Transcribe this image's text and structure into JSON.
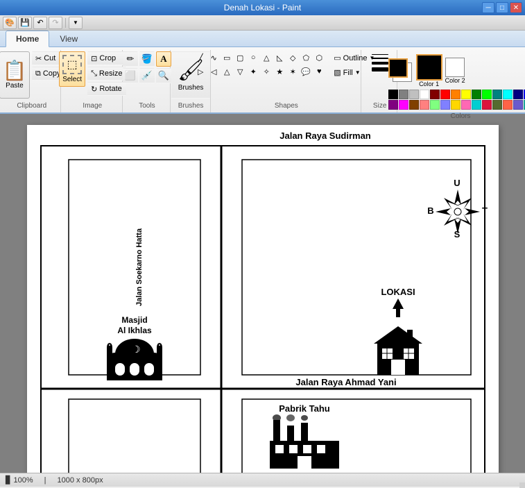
{
  "titleBar": {
    "title": "Denah Lokasi - Paint",
    "minBtn": "─",
    "maxBtn": "□",
    "closeBtn": "✕"
  },
  "quickAccess": {
    "saveLabel": "💾",
    "undoLabel": "↶",
    "redoLabel": "↷"
  },
  "tabs": {
    "items": [
      {
        "id": "home",
        "label": "Home",
        "active": true
      },
      {
        "id": "view",
        "label": "View",
        "active": false
      }
    ]
  },
  "ribbon": {
    "groups": [
      {
        "id": "clipboard",
        "label": "Clipboard",
        "pasteLabel": "Paste",
        "cutLabel": "Cut",
        "copyLabel": "Copy"
      },
      {
        "id": "image",
        "label": "Image",
        "selectLabel": "Select",
        "cropLabel": "Crop",
        "resizeLabel": "Resize",
        "rotateLabel": "Rotate"
      },
      {
        "id": "tools",
        "label": "Tools"
      },
      {
        "id": "brushes",
        "label": "Brushes",
        "brushesLabel": "Brushes"
      },
      {
        "id": "shapes",
        "label": "Shapes",
        "outlineLabel": "Outline",
        "fillLabel": "Fill"
      },
      {
        "id": "size",
        "label": "Size"
      },
      {
        "id": "colors",
        "label": "Colors",
        "color1Label": "Color 1",
        "color2Label": "Color 2"
      }
    ]
  },
  "map": {
    "roadTop": "Jalan Raya Sudirman",
    "roadBottom": "Jalan Raya Ahmad Yani",
    "roadVertical": "Jalan Soekarno Hatta",
    "lokasi": "LOKASI",
    "masjidName": "Masjid",
    "masjidName2": "Al Ikhlas",
    "pabrikName": "Pabrik Tahu",
    "compassN": "U",
    "compassS": "S",
    "compassE": "T",
    "compassW": "B"
  },
  "statusBar": {
    "coords": "100%",
    "dimensions": "1000 x 800px"
  },
  "palette": [
    "#000000",
    "#808080",
    "#c0c0c0",
    "#ffffff",
    "#800000",
    "#ff0000",
    "#ff8000",
    "#ffff00",
    "#008000",
    "#00ff00",
    "#008080",
    "#00ffff",
    "#000080",
    "#0000ff",
    "#800080",
    "#ff00ff",
    "#804000",
    "#ff8080",
    "#80ff80",
    "#8080ff",
    "#ffd700",
    "#ff69b4",
    "#00ced1",
    "#dc143c",
    "#556b2f",
    "#ff6347",
    "#6a5acd",
    "#20b2aa"
  ]
}
